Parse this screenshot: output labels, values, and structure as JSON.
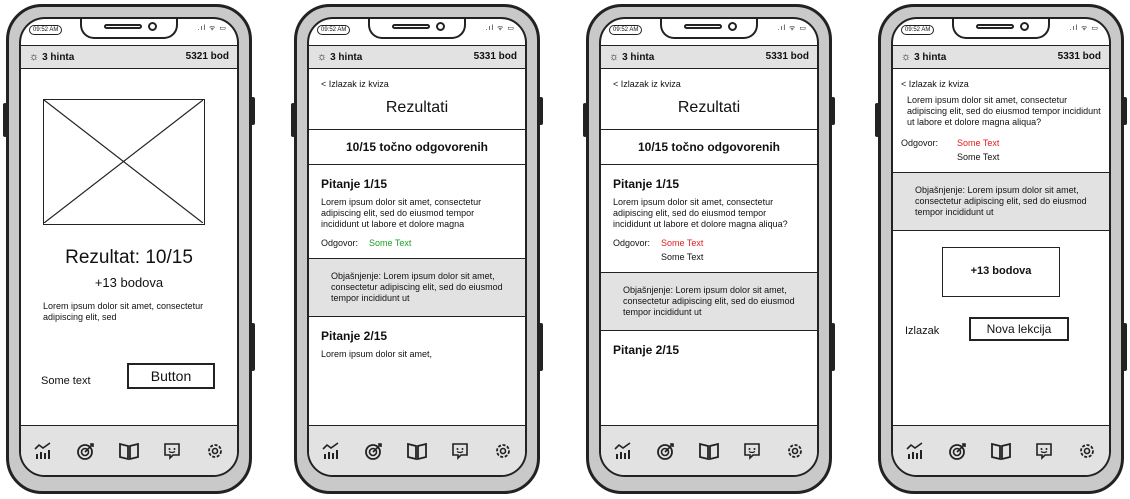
{
  "status_bar": {
    "time": "09:52 AM"
  },
  "screens": [
    {
      "hints": "3 hinta",
      "points": "5321 bod",
      "result_title": "Rezultat: 10/15",
      "points_gained": "+13 bodova",
      "description": "Lorem ipsum dolor sit amet, consectetur adipiscing elit, sed",
      "some_text": "Some text",
      "button_label": "Button"
    },
    {
      "hints": "3 hinta",
      "points": "5331 bod",
      "back_link": "< Izlazak iz kviza",
      "heading": "Rezultati",
      "score_summary": "10/15 točno odgovorenih",
      "question1_title": "Pitanje 1/15",
      "question1_text": "Lorem ipsum dolor sit amet, consectetur adipiscing elit, sed do eiusmod tempor incididunt ut labore et dolore magna",
      "answer_label": "Odgovor:",
      "answer_value": "Some Text",
      "explanation": "Objašnjenje: Lorem ipsum dolor sit amet, consectetur adipiscing elit, sed do eiusmod tempor incididunt ut",
      "question2_title": "Pitanje 2/15",
      "question2_text": "Lorem ipsum dolor sit amet,"
    },
    {
      "hints": "3 hinta",
      "points": "5331 bod",
      "back_link": "< Izlazak iz kviza",
      "heading": "Rezultati",
      "score_summary": "10/15 točno odgovorenih",
      "question1_title": "Pitanje 1/15",
      "question1_text": "Lorem ipsum dolor sit amet, consectetur adipiscing elit, sed do eiusmod tempor incididunt ut labore et dolore magna aliqua?",
      "answer_label": "Odgovor:",
      "wrong_answer": "Some Text",
      "correct_answer": "Some Text",
      "explanation": "Objašnjenje: Lorem ipsum dolor sit amet, consectetur adipiscing elit, sed do eiusmod tempor incididunt ut",
      "question2_title": "Pitanje 2/15"
    },
    {
      "hints": "3 hinta",
      "points": "5331 bod",
      "back_link": "< Izlazak iz kviza",
      "question_text": "Lorem ipsum dolor sit amet, consectetur adipiscing elit, sed do eiusmod tempor incididunt ut labore et dolore magna aliqua?",
      "answer_label": "Odgovor:",
      "wrong_answer": "Some Text",
      "correct_answer": "Some Text",
      "explanation": "Objašnjenje: Lorem ipsum dolor sit amet, consectetur adipiscing elit, sed do eiusmod tempor incididunt ut",
      "points_gained": "+13 bodova",
      "exit_label": "Izlazak",
      "next_button": "Nova lekcija"
    }
  ],
  "nav_icons": [
    "stats-icon",
    "target-icon",
    "book-icon",
    "chat-icon",
    "settings-icon"
  ],
  "colors": {
    "correct": "#21a121",
    "wrong": "#e02020",
    "bar_gray": "#e2e2e2"
  }
}
